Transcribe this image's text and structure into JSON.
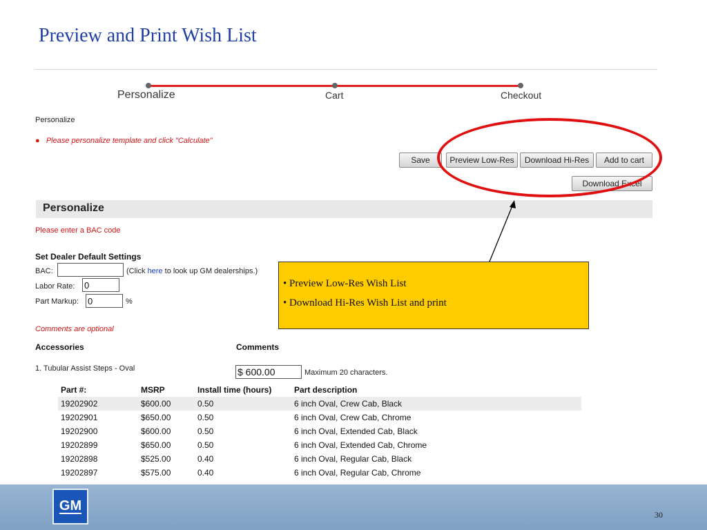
{
  "slide": {
    "title": "Preview and Print Wish List",
    "page_number": "30"
  },
  "progress": {
    "steps": [
      "Personalize",
      "Cart",
      "Checkout"
    ],
    "accent_color": "#e31b1b"
  },
  "personalize_header": "Personalize",
  "instruction": "Please personalize template and click \"Calculate\"",
  "buttons": {
    "save": "Save",
    "preview_low_res": "Preview Low-Res",
    "download_hi_res": "Download Hi-Res",
    "add_to_cart": "Add to cart",
    "download_excel": "Download Excel"
  },
  "section_title": "Personalize",
  "bac_warning": "Please enter a BAC code",
  "dealer_settings": {
    "heading": "Set Dealer Default Settings",
    "bac_label": "BAC:",
    "bac_value": "",
    "lookup_prefix": "(Click ",
    "lookup_link": "here",
    "lookup_suffix": " to look up GM dealerships.)",
    "labor_rate_label": "Labor Rate:",
    "labor_rate_value": "0",
    "part_markup_label": "Part Markup:",
    "part_markup_value": "0",
    "percent": "%"
  },
  "comments_note": "Comments are optional",
  "accessories": {
    "heading": "Accessories",
    "comments_heading": "Comments",
    "item_label": "1. Tubular Assist Steps - Oval",
    "comment_value": "$ 600.00",
    "max_note": "Maximum 20 characters."
  },
  "callout": {
    "line1": "• Preview Low-Res Wish List",
    "line2": "• Download Hi-Res Wish List and print"
  },
  "parts_table": {
    "headers": [
      "Part #:",
      "MSRP",
      "Install time (hours)",
      "Part description"
    ],
    "rows": [
      [
        "19202902",
        "$600.00",
        "0.50",
        "6 inch Oval, Crew Cab, Black"
      ],
      [
        "19202901",
        "$650.00",
        "0.50",
        "6 inch Oval, Crew Cab, Chrome"
      ],
      [
        "19202900",
        "$600.00",
        "0.50",
        "6 inch Oval, Extended Cab, Black"
      ],
      [
        "19202899",
        "$650.00",
        "0.50",
        "6 inch Oval, Extended Cab, Chrome"
      ],
      [
        "19202898",
        "$525.00",
        "0.40",
        "6 inch Oval, Regular Cab, Black"
      ],
      [
        "19202897",
        "$575.00",
        "0.40",
        "6 inch Oval, Regular Cab, Chrome"
      ]
    ]
  },
  "logo": {
    "text": "GM",
    "color": "#1a56b8"
  }
}
